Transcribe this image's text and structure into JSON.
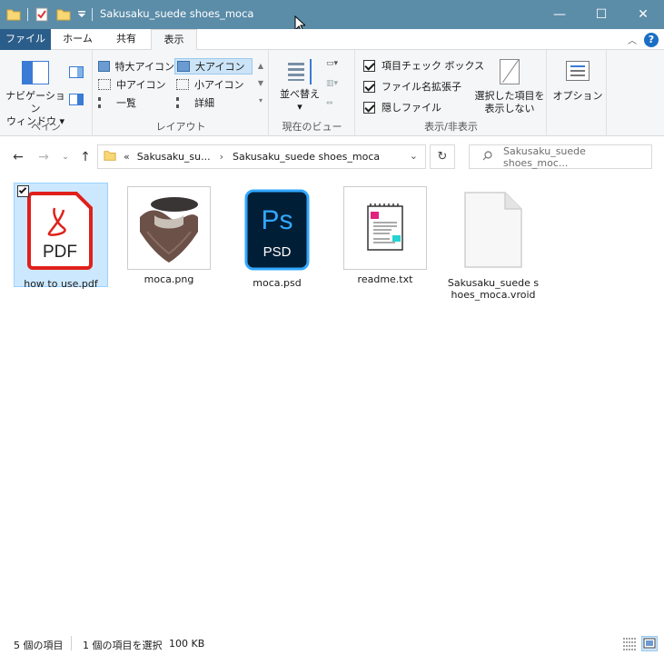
{
  "window": {
    "title": "Sakusaku_suede shoes_moca",
    "minimize": "—",
    "maximize": "☐",
    "close": "✕"
  },
  "ribbon_tabs": {
    "file": "ファイル",
    "home": "ホーム",
    "share": "共有",
    "view": "表示"
  },
  "ribbon": {
    "pane": {
      "nav_pane_line1": "ナビゲーション",
      "nav_pane_line2": "ウィンドウ",
      "group_label": "ペイン"
    },
    "layout": {
      "extra_large": "特大アイコン",
      "large": "大アイコン",
      "medium": "中アイコン",
      "small": "小アイコン",
      "list": "一覧",
      "details": "詳細",
      "group_label": "レイアウト",
      "selected": "大アイコン"
    },
    "current_view": {
      "sort_line1": "並べ替え",
      "group_label": "現在のビュー"
    },
    "show_hide": {
      "item_checkbox": "項目チェック ボックス",
      "file_ext": "ファイル名拡張子",
      "hidden": "隠しファイル",
      "item_checkbox_checked": true,
      "file_ext_checked": true,
      "hidden_checked": true,
      "hide_selected_line1": "選択した項目を",
      "hide_selected_line2": "表示しない",
      "group_label": "表示/非表示"
    },
    "options": {
      "label": "オプション"
    }
  },
  "address": {
    "prefix": "«",
    "crumb1": "Sakusaku_su...",
    "crumb2": "Sakusaku_suede shoes_moca",
    "search_placeholder": "Sakusaku_suede shoes_moc..."
  },
  "files": [
    {
      "name": "how to use.pdf",
      "type": "pdf",
      "selected": true,
      "badge": "PDF"
    },
    {
      "name": "moca.png",
      "type": "png",
      "selected": false
    },
    {
      "name": "moca.psd",
      "type": "psd",
      "selected": false,
      "badge_top": "Ps",
      "badge_bottom": "PSD"
    },
    {
      "name": "readme.txt",
      "type": "txt",
      "selected": false
    },
    {
      "name": "Sakusaku_suede shoes_moca.vroid",
      "type": "vroid",
      "selected": false
    }
  ],
  "status": {
    "count": "5 個の項目",
    "selection": "1 個の項目を選択",
    "size": "100 KB"
  },
  "colors": {
    "titlebar": "#5b8ca8",
    "file_tab": "#2b5d8a",
    "selection": "#cce8ff",
    "pdf_red": "#e0201b",
    "psd_blue": "#31a8ff",
    "psd_bg": "#001e36"
  }
}
